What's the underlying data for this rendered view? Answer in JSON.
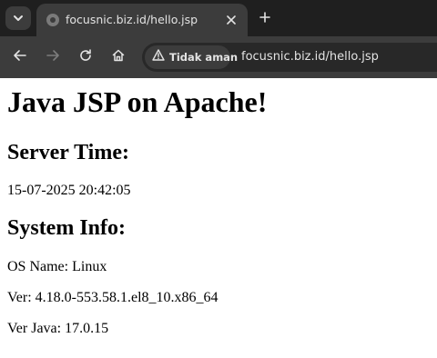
{
  "browser": {
    "tab": {
      "title": "focusnic.biz.id/hello.jsp",
      "favicon": "globe-icon"
    },
    "toolbar": {
      "icons": [
        "back-arrow-icon",
        "forward-arrow-icon",
        "reload-icon",
        "home-icon"
      ],
      "security_label": "Tidak aman",
      "security_icon": "warning-triangle-icon",
      "url": "focusnic.biz.id/hello.jsp"
    }
  },
  "page": {
    "title": "Java JSP on Apache!",
    "server_time_heading": "Server Time:",
    "server_time": "15-07-2025 20:42:05",
    "system_info_heading": "System Info:",
    "os_name": "OS Name: Linux",
    "os_version": "Ver: 4.18.0-553.58.1.el8_10.x86_64",
    "java_version": "Ver Java: 17.0.15"
  }
}
